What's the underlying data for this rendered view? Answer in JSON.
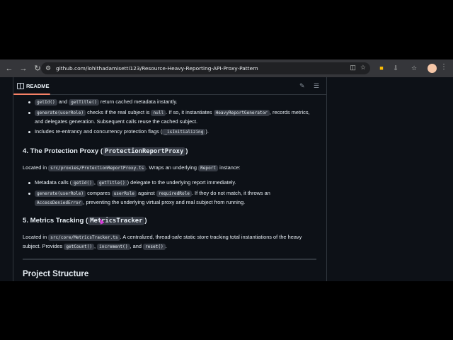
{
  "browser": {
    "url": "github.com/lohithadamisetti123/Resource-Heavy-Reporting-API-Proxy-Pattern",
    "icons": [
      "back-icon",
      "forward-icon",
      "reload-icon",
      "site-info-icon",
      "cast-icon",
      "bookmark-star-icon",
      "extension-yellow-icon",
      "extension-download-icon",
      "extensions-puzzle-icon",
      "bookmarks-icon",
      "profile-avatar",
      "menu-icon"
    ]
  },
  "readme": {
    "title": "README"
  },
  "content": {
    "section3_items": [
      {
        "a": "getId()",
        "b": " and ",
        "c": "getTitle()",
        "d": " return cached metadata instantly."
      },
      {
        "a": "generate(userRole)",
        "b": " checks if the real subject is ",
        "c": "null",
        "d": ". If so, it instantiates ",
        "e": "HeavyReportGenerator",
        "f": ", records metrics, and delegates generation. Subsequent calls reuse the cached subject."
      },
      {
        "a": "Includes re-entrancy and concurrency protection flags (",
        "b": "_isInitializing",
        "c": ")."
      }
    ],
    "section4": {
      "heading": "4. The Protection Proxy (",
      "heading_code": "ProtectionReportProxy",
      "heading_end": ")",
      "intro_a": "Located in ",
      "intro_code": "src/proxies/ProtectionReportProxy.ts",
      "intro_b": ". Wraps an underlying ",
      "intro_code2": "Report",
      "intro_c": " instance:",
      "item1_a": "Metadata calls (",
      "item1_code1": "getId()",
      "item1_b": ", ",
      "item1_code2": "getTitle()",
      "item1_c": ") delegate to the underlying report immediately.",
      "item2_code1": "generate(userRole)",
      "item2_a": " compares ",
      "item2_code2": "userRole",
      "item2_b": " against ",
      "item2_code3": "requiredRole",
      "item2_c": ". If they do not match, it throws an ",
      "item2_code4": "AccessDeniedError",
      "item2_d": ", preventing the underlying virtual proxy and real subject from running."
    },
    "section5": {
      "heading": "5. Metrics Tracking (",
      "heading_code": "MetricsTracker",
      "heading_end": ")",
      "p_a": "Located in ",
      "p_code1": "src/core/MetricsTracker.ts",
      "p_b": ". A centralized, thread-safe static store tracking total instantiations of the heavy subject. Provides ",
      "p_code2": "getCount()",
      "p_c": ", ",
      "p_code3": "increment()",
      "p_d": ", and ",
      "p_code4": "reset()",
      "p_e": "."
    },
    "section_project": {
      "heading": "Project Structure"
    }
  }
}
